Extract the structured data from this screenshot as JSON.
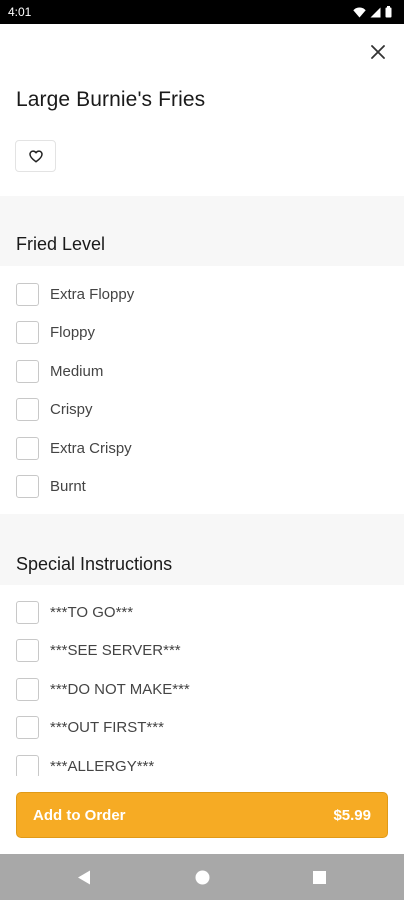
{
  "status_bar": {
    "time": "4:01"
  },
  "item": {
    "title": "Large Burnie's Fries"
  },
  "sections": [
    {
      "title": "Fried Level",
      "options": [
        {
          "label": "Extra Floppy",
          "checked": false
        },
        {
          "label": "Floppy",
          "checked": false
        },
        {
          "label": "Medium",
          "checked": false
        },
        {
          "label": "Crispy",
          "checked": false
        },
        {
          "label": "Extra Crispy",
          "checked": false
        },
        {
          "label": "Burnt",
          "checked": false
        }
      ]
    },
    {
      "title": "Special Instructions",
      "options": [
        {
          "label": "***TO GO***",
          "checked": false
        },
        {
          "label": "***SEE SERVER***",
          "checked": false
        },
        {
          "label": "***DO NOT MAKE***",
          "checked": false
        },
        {
          "label": "***OUT FIRST***",
          "checked": false
        },
        {
          "label": "***ALLERGY***",
          "checked": false
        }
      ]
    }
  ],
  "footer": {
    "add_label": "Add to Order",
    "price": "$5.99"
  },
  "colors": {
    "accent": "#f6ab24",
    "section_band": "#f7f7f7",
    "nav_bar": "#a8a8a8"
  },
  "icons": {
    "close": "close-icon",
    "favorite": "heart-outline-icon",
    "wifi": "wifi-icon",
    "signal": "signal-icon",
    "battery": "battery-icon",
    "back": "back-triangle-icon",
    "home": "home-circle-icon",
    "recents": "recents-square-icon"
  }
}
